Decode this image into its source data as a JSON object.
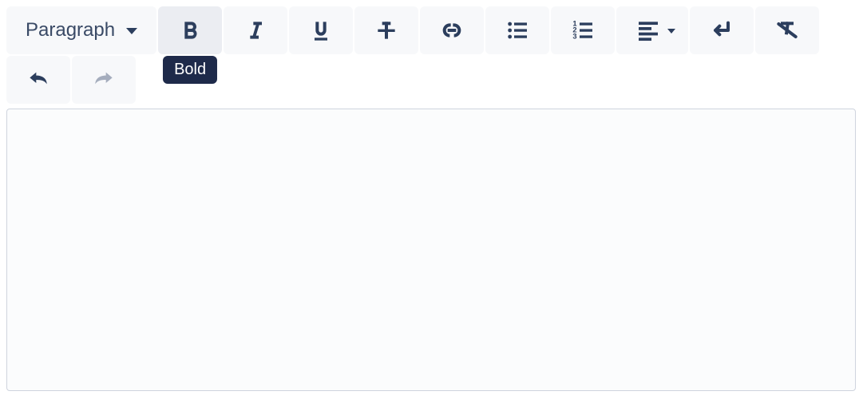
{
  "toolbar": {
    "style_label": "Paragraph",
    "bold_tooltip": "Bold"
  }
}
